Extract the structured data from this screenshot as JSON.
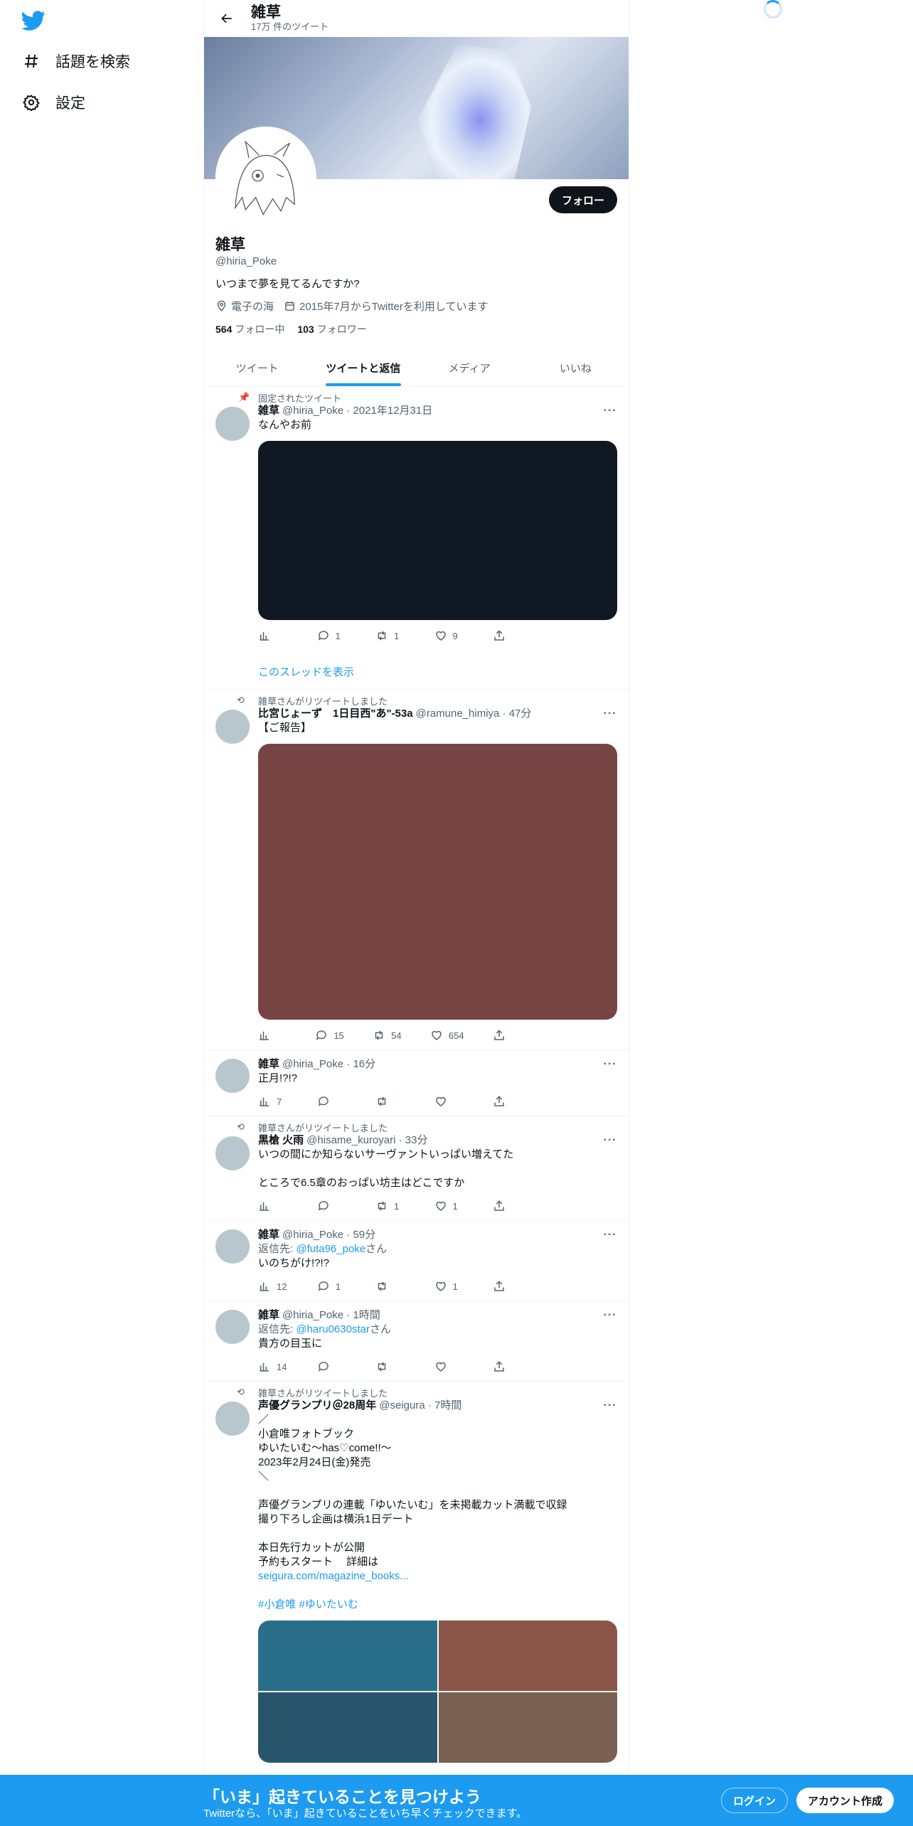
{
  "nav": {
    "explore_label": "話題を検索",
    "settings_label": "設定"
  },
  "header": {
    "title": "雑草",
    "subtitle": "17万 件のツイート"
  },
  "profile": {
    "follow_label": "フォロー",
    "name": "雑草",
    "handle": "@hiria_Poke",
    "bio": "いつまで夢を見てるんですか?",
    "location": "電子の海",
    "joined": "2015年7月からTwitterを利用しています",
    "following_count": "564",
    "following_label": "フォロー中",
    "followers_count": "103",
    "followers_label": "フォロワー"
  },
  "tabs": [
    "ツイート",
    "ツイートと返信",
    "メディア",
    "いいね"
  ],
  "tweets": [
    {
      "context": "固定されたツイート",
      "name": "雑草",
      "meta": "@hiria_Poke · 2021年12月31日",
      "text": "なんやお前",
      "views": "",
      "replies": "1",
      "retweets": "1",
      "likes": "9",
      "thread_link": "このスレッドを表示"
    },
    {
      "context": "雑草さんがリツイートしました",
      "name": "比宮じょーず　1日目西\"あ\"-53a",
      "meta": "@ramune_himiya · 47分",
      "text": "【ご報告】",
      "views": "",
      "replies": "15",
      "retweets": "54",
      "likes": "654"
    },
    {
      "name": "雑草",
      "meta": "@hiria_Poke · 16分",
      "text": "正月!?!?",
      "views": "7",
      "replies": "",
      "retweets": "",
      "likes": ""
    },
    {
      "context": "雑草さんがリツイートしました",
      "name": "黒槍 火雨",
      "meta": "@hisame_kuroyari · 33分",
      "text": "いつの間にか知らないサーヴァントいっぱい増えてた\n\nところで6.5章のおっぱい坊主はどこですか",
      "views": "",
      "replies": "",
      "retweets": "1",
      "likes": "1"
    },
    {
      "name": "雑草",
      "meta": "@hiria_Poke · 59分",
      "reply_prefix": "返信先: ",
      "reply_to": "@futa96_poke",
      "reply_suffix": "さん",
      "text": "いのちがけ!?!?",
      "views": "12",
      "replies": "1",
      "retweets": "",
      "likes": "1"
    },
    {
      "name": "雑草",
      "meta": "@hiria_Poke · 1時間",
      "reply_prefix": "返信先: ",
      "reply_to": "@haru0630star",
      "reply_suffix": "さん",
      "text": "貴方の目玉に",
      "views": "14",
      "replies": "",
      "retweets": "",
      "likes": ""
    },
    {
      "context": "雑草さんがリツイートしました",
      "name": "声優グランプリ＠28周年",
      "meta": "@seigura · 7時間",
      "text": "／\n小倉唯フォトブック\nゆいたいむ〜has♡come!!〜\n2023年2月24日(金)発売\n＼\n\n声優グランプリの連載「ゆいたいむ」を未掲載カット満載で収録\n撮り下ろし企画は横浜1日デート\n\n本日先行カットが公開\n予約もスタート　 詳細は",
      "link": "seigura.com/magazine_books...",
      "hashtags": "#小倉唯 #ゆいたいむ"
    }
  ],
  "bottom_bar": {
    "title": "「いま」起きていることを見つけよう",
    "subtitle": "Twitterなら、「いま」起きていることをいち早くチェックできます。",
    "login_label": "ログイン",
    "signup_label": "アカウント作成"
  },
  "colors": {
    "accent": "#1d9bf0",
    "media_dark": "#0f1823",
    "media_red": "#774444",
    "grid_teal": "#2a6f8a",
    "grid_brown": "#8a5548"
  }
}
